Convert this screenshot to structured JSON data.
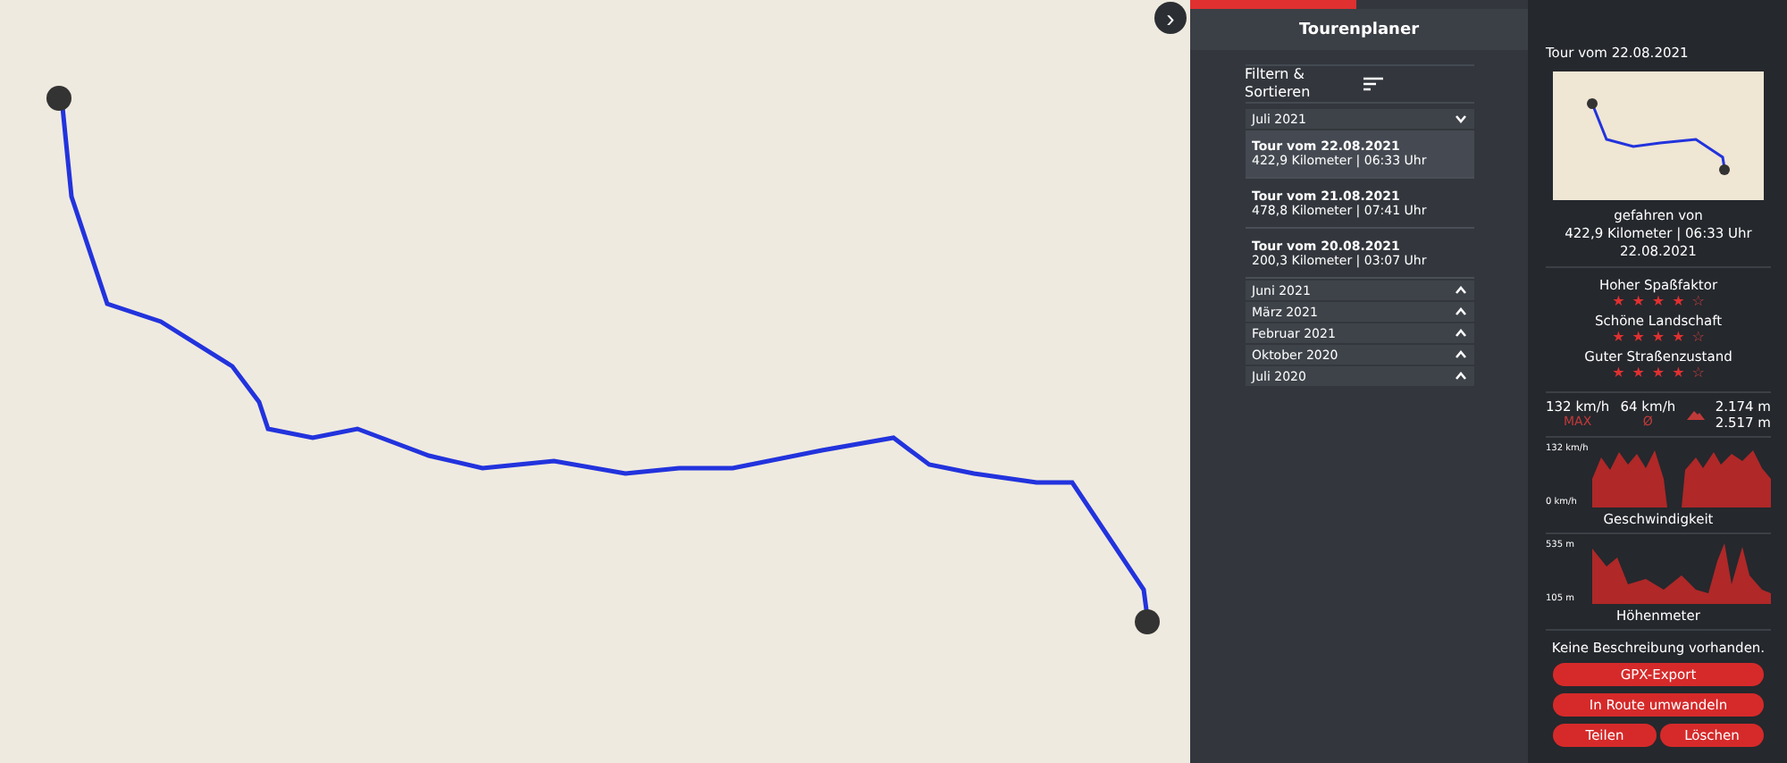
{
  "map": {
    "collapse_button": "›"
  },
  "planner": {
    "title": "Tourenplaner",
    "filter_label": "Filtern & Sortieren",
    "groups": [
      {
        "label": "Juli 2021",
        "expanded": true,
        "tours": [
          {
            "title": "Tour vom 22.08.2021",
            "info": "422,9 Kilometer | 06:33 Uhr",
            "selected": true
          },
          {
            "title": "Tour vom 21.08.2021",
            "info": "478,8 Kilometer | 07:41 Uhr",
            "selected": false
          },
          {
            "title": "Tour vom 20.08.2021",
            "info": "200,3 Kilometer | 03:07 Uhr",
            "selected": false
          }
        ]
      },
      {
        "label": "Juni 2021",
        "expanded": false
      },
      {
        "label": "März 2021",
        "expanded": false
      },
      {
        "label": "Februar 2021",
        "expanded": false
      },
      {
        "label": "Oktober 2020",
        "expanded": false
      },
      {
        "label": "Juli 2020",
        "expanded": false
      }
    ]
  },
  "detail": {
    "title": "Tour vom 22.08.2021",
    "driven_by": "gefahren von",
    "stats_line": "422,9 Kilometer | 06:33 Uhr",
    "date": "22.08.2021",
    "ratings": [
      {
        "label": "Hoher Spaßfaktor",
        "stars": 4
      },
      {
        "label": "Schöne Landschaft",
        "stars": 4
      },
      {
        "label": "Guter Straßenzustand",
        "stars": 4
      }
    ],
    "max_speed": "132 km/h",
    "max_label": "MAX",
    "avg_speed": "64 km/h",
    "avg_label": "Ø",
    "ascent": "2.174 m",
    "descent": "2.517 m",
    "speed_chart": {
      "top": "132 km/h",
      "bottom": "0 km/h",
      "title": "Geschwindigkeit"
    },
    "elevation_chart": {
      "top": "535 m",
      "bottom": "105 m",
      "title": "Höhenmeter"
    },
    "description": "Keine Beschreibung vorhanden.",
    "buttons": [
      "GPX-Export",
      "In Route umwandeln"
    ],
    "small_buttons": [
      "Teilen",
      "Löschen"
    ]
  }
}
